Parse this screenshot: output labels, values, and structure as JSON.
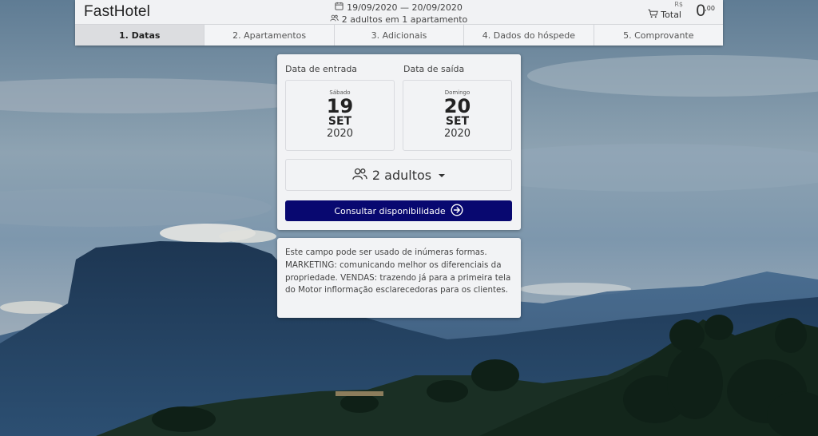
{
  "header": {
    "brand": "FastHotel",
    "date_range": "19/09/2020 — 20/09/2020",
    "occupancy": "2 adultos em 1 apartamento",
    "currency": "R$",
    "total_label": "Total",
    "total_value": "0",
    "total_cents": ",00"
  },
  "tabs": [
    {
      "label": "1. Datas",
      "active": true
    },
    {
      "label": "2. Apartamentos",
      "active": false
    },
    {
      "label": "3. Adicionais",
      "active": false
    },
    {
      "label": "4. Dados do hóspede",
      "active": false
    },
    {
      "label": "5. Comprovante",
      "active": false
    }
  ],
  "booking": {
    "checkin": {
      "label": "Data de entrada",
      "weekday": "Sábado",
      "day": "19",
      "month": "SET",
      "year": "2020"
    },
    "checkout": {
      "label": "Data de saída",
      "weekday": "Domingo",
      "day": "20",
      "month": "SET",
      "year": "2020"
    },
    "guests_label": "2 adultos",
    "consult_button": "Consultar disponibilidade"
  },
  "info_text": "Este campo pode ser usado de inúmeras formas. MARKETING: comunicando melhor os diferenciais da propriedade. VENDAS: trazendo já para a primeira tela do Motor inflormação esclarecedoras para os clientes.",
  "colors": {
    "primary_button": "#080870",
    "active_tab": "#dcdde0"
  },
  "icons": [
    "calendar-icon",
    "users-icon",
    "cart-icon",
    "caret-down-icon",
    "arrow-circle-right-icon"
  ]
}
